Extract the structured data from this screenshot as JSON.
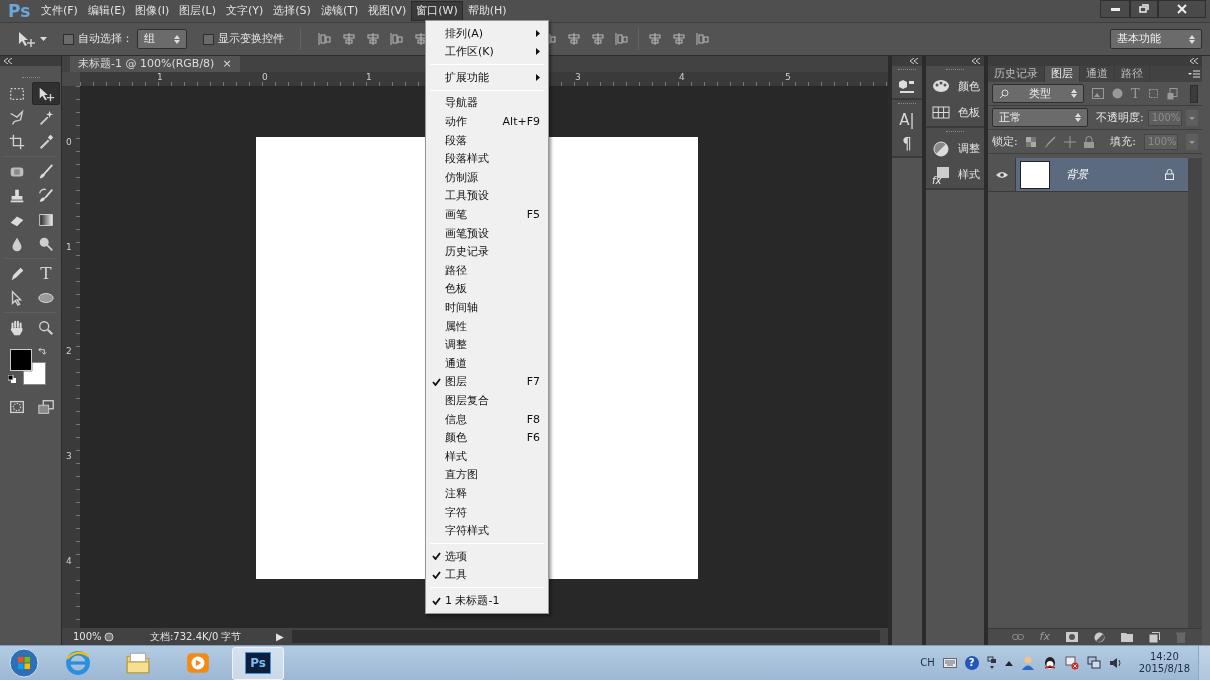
{
  "menubar": {
    "logo": "Ps",
    "items": [
      {
        "label": "文件(F)",
        "selected": false
      },
      {
        "label": "编辑(E)",
        "selected": false
      },
      {
        "label": "图像(I)",
        "selected": false
      },
      {
        "label": "图层(L)",
        "selected": false
      },
      {
        "label": "文字(Y)",
        "selected": false
      },
      {
        "label": "选择(S)",
        "selected": false
      },
      {
        "label": "滤镜(T)",
        "selected": false
      },
      {
        "label": "视图(V)",
        "selected": false
      },
      {
        "label": "窗口(W)",
        "selected": true
      },
      {
        "label": "帮助(H)",
        "selected": false
      }
    ]
  },
  "options_bar": {
    "auto_select": {
      "label": "自动选择：",
      "checked": false
    },
    "auto_select_target": "组",
    "transform_controls": {
      "label": "显示变换控件",
      "checked": false
    },
    "workspace": "基本功能"
  },
  "document": {
    "tab": {
      "title": "未标题-1 @ 100%(RGB/8)",
      "close": "×"
    },
    "top_ruler": [
      "1",
      "0",
      "1",
      "3",
      "4",
      "5"
    ],
    "left_ruler": [
      "0",
      "1",
      "2",
      "3",
      "4"
    ],
    "status": {
      "zoom": "100%",
      "info": "文档:732.4K/0 字节",
      "arrow": "▶"
    }
  },
  "tools": [
    {
      "kind": "marquee",
      "selected": false
    },
    {
      "kind": "move",
      "selected": true
    },
    {
      "kind": "lasso",
      "selected": false
    },
    {
      "kind": "wand",
      "selected": false
    },
    {
      "kind": "crop",
      "selected": false
    },
    {
      "kind": "eyedropper",
      "selected": false
    },
    {
      "kind": "bandage",
      "selected": false
    },
    {
      "kind": "brush",
      "selected": false
    },
    {
      "kind": "stamp",
      "selected": false
    },
    {
      "kind": "histbrush",
      "selected": false
    },
    {
      "kind": "eraser",
      "selected": false
    },
    {
      "kind": "gradient",
      "selected": false
    },
    {
      "kind": "drop",
      "selected": false
    },
    {
      "kind": "dodge",
      "selected": false
    },
    {
      "kind": "pen",
      "selected": false
    },
    {
      "kind": "text",
      "glyph": "T",
      "selected": false
    },
    {
      "kind": "pathsel",
      "selected": false
    },
    {
      "kind": "ellipse",
      "selected": false
    },
    {
      "kind": "hand",
      "selected": false
    },
    {
      "kind": "zoom",
      "selected": false
    }
  ],
  "icon_strip": [
    {
      "kind": "cube"
    },
    {
      "kind": "glyph",
      "glyph": "A|"
    },
    {
      "kind": "glyph",
      "glyph": "¶"
    }
  ],
  "side_panels": [
    [
      {
        "kind": "palette",
        "label": "颜色"
      },
      {
        "kind": "swatches",
        "label": "色板"
      }
    ],
    [
      {
        "kind": "adjust",
        "label": "调整"
      },
      {
        "kind": "styles",
        "label": "样式",
        "glyph": "fx"
      }
    ]
  ],
  "layers_panel": {
    "tabs": [
      {
        "label": "历史记录",
        "selected": false
      },
      {
        "label": "图层",
        "selected": true
      },
      {
        "label": "通道",
        "selected": false
      },
      {
        "label": "路径",
        "selected": false
      }
    ],
    "filter": "类型",
    "filter_text_glyph": "T",
    "blend_mode": "正常",
    "opacity_label": "不透明度:",
    "opacity": "100%",
    "lock_label": "锁定:",
    "fill_label": "填充:",
    "fill": "100%",
    "layers": [
      {
        "name": "背景",
        "selected": true,
        "visible": true,
        "locked": true
      }
    ],
    "footer_fx": "fx"
  },
  "window_menu": {
    "items": [
      {
        "kind": "submenu",
        "label": "排列(A)"
      },
      {
        "kind": "submenu",
        "label": "工作区(K)"
      },
      {
        "kind": "separator"
      },
      {
        "kind": "submenu",
        "label": "扩展功能"
      },
      {
        "kind": "separator"
      },
      {
        "kind": "item",
        "label": "导航器",
        "checked": false
      },
      {
        "kind": "item",
        "label": "动作",
        "shortcut": "Alt+F9",
        "checked": false
      },
      {
        "kind": "item",
        "label": "段落",
        "checked": false
      },
      {
        "kind": "item",
        "label": "段落样式",
        "checked": false
      },
      {
        "kind": "item",
        "label": "仿制源",
        "checked": false
      },
      {
        "kind": "item",
        "label": "工具预设",
        "checked": false
      },
      {
        "kind": "item",
        "label": "画笔",
        "shortcut": "F5",
        "checked": false
      },
      {
        "kind": "item",
        "label": "画笔预设",
        "checked": false
      },
      {
        "kind": "item",
        "label": "历史记录",
        "checked": false
      },
      {
        "kind": "item",
        "label": "路径",
        "checked": false
      },
      {
        "kind": "item",
        "label": "色板",
        "checked": false
      },
      {
        "kind": "item",
        "label": "时间轴",
        "checked": false
      },
      {
        "kind": "item",
        "label": "属性",
        "checked": false
      },
      {
        "kind": "item",
        "label": "调整",
        "checked": false
      },
      {
        "kind": "item",
        "label": "通道",
        "checked": false
      },
      {
        "kind": "item",
        "label": "图层",
        "shortcut": "F7",
        "checked": true
      },
      {
        "kind": "item",
        "label": "图层复合",
        "checked": false
      },
      {
        "kind": "item",
        "label": "信息",
        "shortcut": "F8",
        "checked": false
      },
      {
        "kind": "item",
        "label": "颜色",
        "shortcut": "F6",
        "checked": false
      },
      {
        "kind": "item",
        "label": "样式",
        "checked": false
      },
      {
        "kind": "item",
        "label": "直方图",
        "checked": false
      },
      {
        "kind": "item",
        "label": "注释",
        "checked": false
      },
      {
        "kind": "item",
        "label": "字符",
        "checked": false
      },
      {
        "kind": "item",
        "label": "字符样式",
        "checked": false
      },
      {
        "kind": "separator"
      },
      {
        "kind": "item",
        "label": "选项",
        "checked": true
      },
      {
        "kind": "item",
        "label": "工具",
        "checked": true
      },
      {
        "kind": "separator"
      },
      {
        "kind": "item",
        "label": "1 未标题-1",
        "checked": true
      }
    ]
  },
  "taskbar": {
    "apps": [
      {
        "kind": "ie",
        "selected": false
      },
      {
        "kind": "folder",
        "selected": false
      },
      {
        "kind": "media",
        "selected": false
      },
      {
        "kind": "ps",
        "label": "Ps",
        "selected": true
      }
    ],
    "tray": {
      "language": "CH",
      "help": "?",
      "time": "14:20",
      "date": "2015/8/18"
    }
  }
}
